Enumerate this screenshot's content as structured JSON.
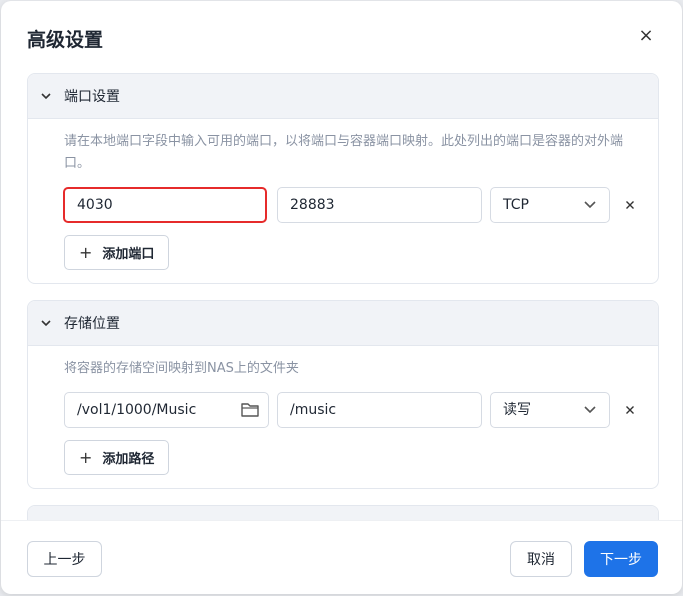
{
  "dialog": {
    "title": "高级设置",
    "close_label": "×"
  },
  "ports": {
    "section_title": "端口设置",
    "description": "请在本地端口字段中输入可用的端口，以将端口与容器端口映射。此处列出的端口是容器的对外端口。",
    "rows": [
      {
        "local_port": "4030",
        "container_port": "28883",
        "protocol": "TCP"
      }
    ],
    "add_label": "添加端口"
  },
  "storage": {
    "section_title": "存储位置",
    "description": "将容器的存储空间映射到NAS上的文件夹",
    "rows": [
      {
        "nas_path": "/vol1/1000/Music",
        "container_path": "/music",
        "permission": "读写"
      }
    ],
    "add_label": "添加路径"
  },
  "footer": {
    "prev_label": "上一步",
    "cancel_label": "取消",
    "next_label": "下一步"
  },
  "colors": {
    "accent": "#1e73e8",
    "highlight_border": "#e62b2b",
    "section_header_bg": "#f1f3f7",
    "description_text": "#8a93a3"
  },
  "icons": {
    "chevron": "chevron-down-icon",
    "select_arrow": "chevron-down-icon",
    "folder": "folder-icon",
    "remove": "close-icon",
    "add": "plus-icon"
  }
}
